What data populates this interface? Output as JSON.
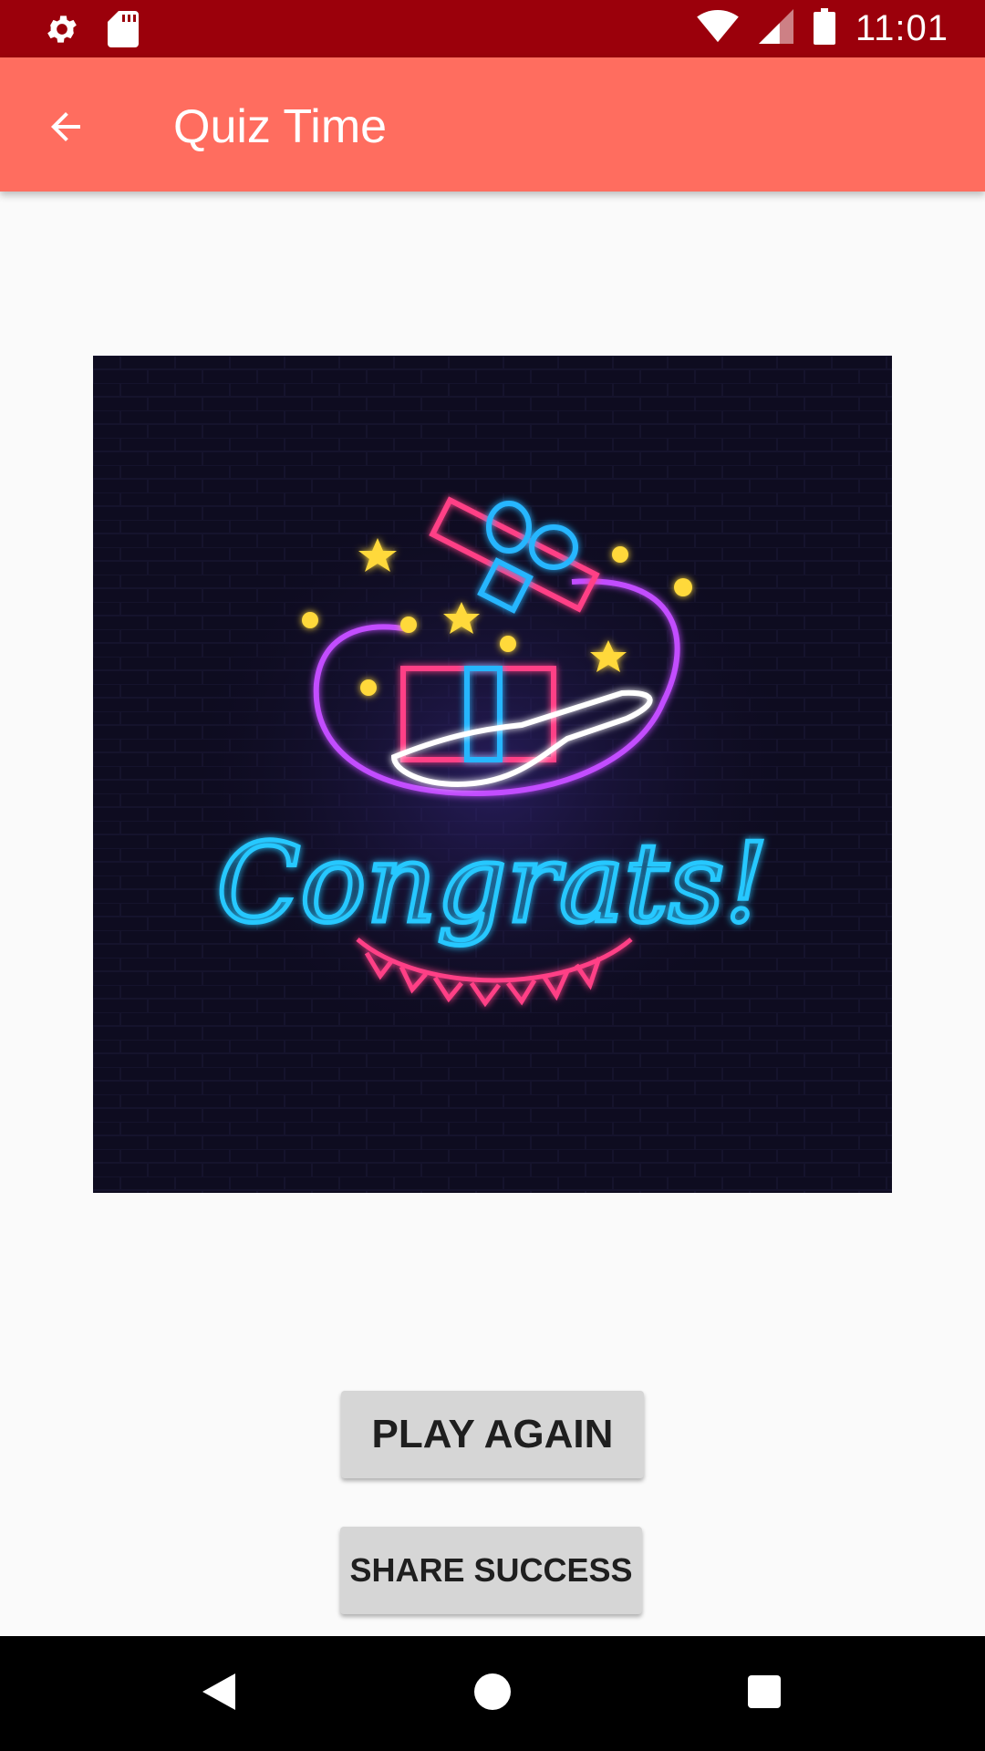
{
  "status_bar": {
    "time": "11:01",
    "icons": [
      "gear-icon",
      "sd-card-icon",
      "wifi-icon",
      "signal-icon",
      "battery-icon"
    ],
    "background": "#9b000b"
  },
  "app_bar": {
    "title": "Quiz Time",
    "back_icon": "arrow-back-icon",
    "background": "#ff6d5f"
  },
  "main": {
    "image": {
      "sign_text": "Congrats!"
    },
    "play_again_label": "PLAY AGAIN",
    "share_success_label": "SHARE SUCCESS"
  },
  "nav_bar": {
    "items": [
      "back-triangle-icon",
      "home-circle-icon",
      "recents-square-icon"
    ]
  }
}
